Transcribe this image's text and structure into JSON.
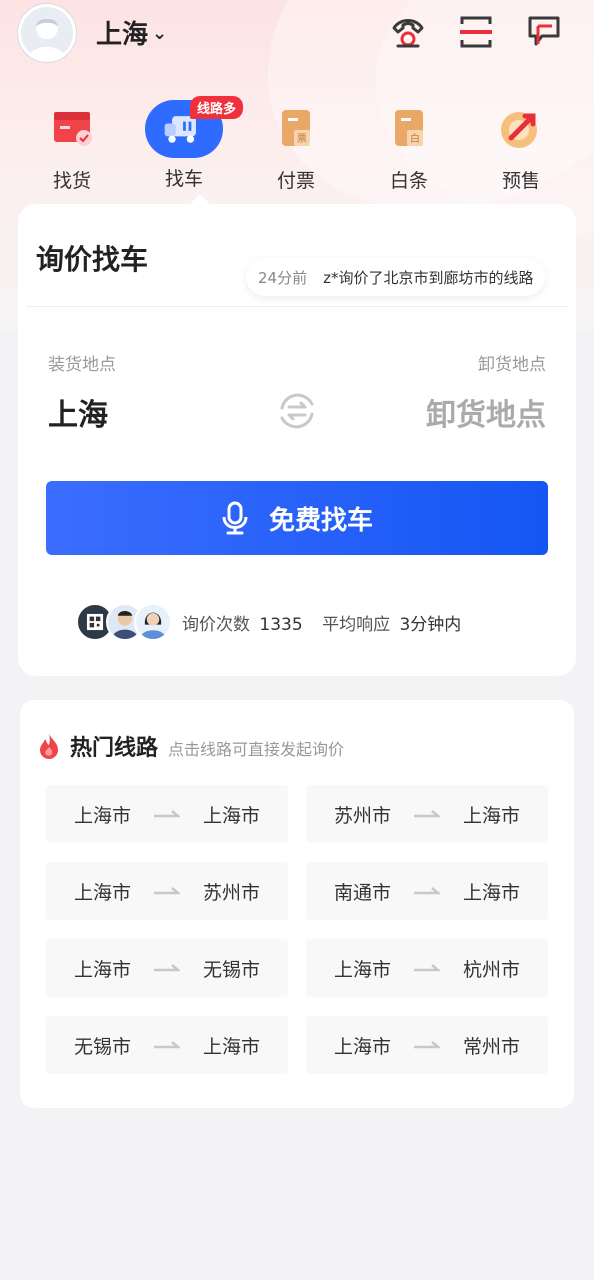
{
  "header": {
    "city": "上海",
    "colors": {
      "accent_red": "#e8303a",
      "primary_blue": "#2f6bff"
    }
  },
  "nav": {
    "items": [
      {
        "label": "找货",
        "icon": "cargo-icon"
      },
      {
        "label": "找车",
        "icon": "truck-icon",
        "active": true
      },
      {
        "label": "付票",
        "icon": "invoice-icon"
      },
      {
        "label": "白条",
        "icon": "credit-note-icon"
      },
      {
        "label": "预售",
        "icon": "presale-icon"
      }
    ],
    "badge": "线路多"
  },
  "inquiry": {
    "title": "询价找车",
    "ticker_time": "24分前",
    "ticker_message": "z*询价了北京市到廊坊市的线路",
    "load_label": "装货地点",
    "load_value": "上海",
    "unload_label": "卸货地点",
    "unload_placeholder": "卸货地点",
    "cta_label": "免费找车",
    "stats_count_label": "询价次数",
    "stats_count_value": "1335",
    "stats_response_label": "平均响应",
    "stats_response_value": "3分钟内"
  },
  "hot_routes": {
    "title": "热门线路",
    "subtitle": "点击线路可直接发起询价",
    "routes": [
      {
        "from": "上海市",
        "to": "上海市"
      },
      {
        "from": "苏州市",
        "to": "上海市"
      },
      {
        "from": "上海市",
        "to": "苏州市"
      },
      {
        "from": "南通市",
        "to": "上海市"
      },
      {
        "from": "上海市",
        "to": "无锡市"
      },
      {
        "from": "上海市",
        "to": "杭州市"
      },
      {
        "from": "无锡市",
        "to": "上海市"
      },
      {
        "from": "上海市",
        "to": "常州市"
      }
    ]
  }
}
